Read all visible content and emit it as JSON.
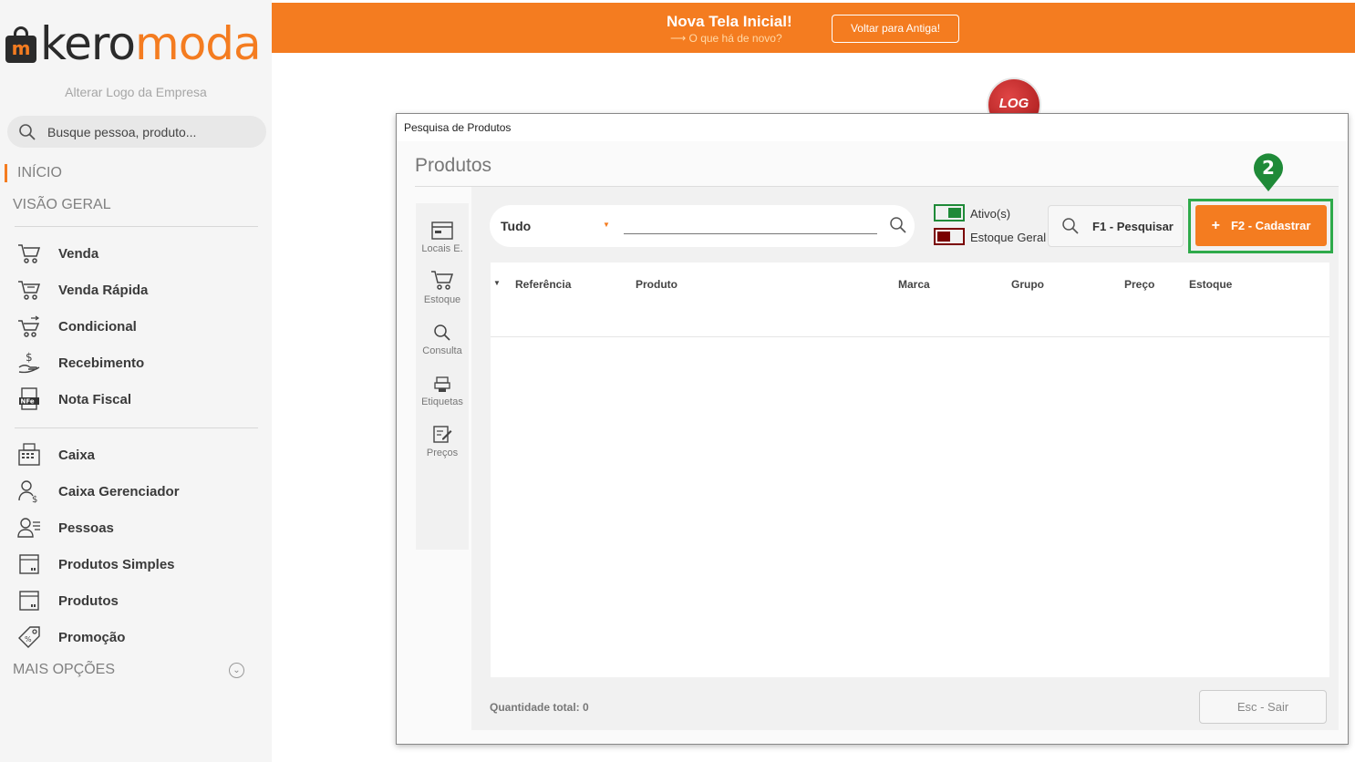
{
  "sidebar": {
    "logo": {
      "part1": "kero",
      "part2": "moda",
      "bag_letter": "m"
    },
    "alter_logo": "Alterar Logo da Empresa",
    "search_placeholder": "Busque pessoa, produto...",
    "section_inicio": "INÍCIO",
    "section_visao": "VISÃO GERAL",
    "items": [
      {
        "label": "Venda",
        "icon": "cart-icon"
      },
      {
        "label": "Venda Rápida",
        "icon": "cart-fast-icon"
      },
      {
        "label": "Condicional",
        "icon": "cart-swap-icon"
      },
      {
        "label": "Recebimento",
        "icon": "dollar-hand-icon"
      },
      {
        "label": "Nota Fiscal",
        "icon": "nfe-icon"
      },
      {
        "label": "Caixa",
        "icon": "cash-register-icon"
      },
      {
        "label": "Caixa Gerenciador",
        "icon": "user-dollar-icon"
      },
      {
        "label": "Pessoas",
        "icon": "people-icon"
      },
      {
        "label": "Produtos Simples",
        "icon": "box-icon"
      },
      {
        "label": "Produtos",
        "icon": "box-icon"
      },
      {
        "label": "Promoção",
        "icon": "tag-icon"
      }
    ],
    "more_options": "MAIS OPÇÕES"
  },
  "banner": {
    "title": "Nova Tela Inicial!",
    "subtitle": "⟶ O que há de novo?",
    "back_button": "Voltar para Antiga!"
  },
  "log_badge": "LOG",
  "dialog": {
    "window_title": "Pesquisa de Produtos",
    "heading": "Produtos",
    "tools": [
      {
        "label": "Locais E.",
        "icon": "locations-icon"
      },
      {
        "label": "Estoque",
        "icon": "cart-icon"
      },
      {
        "label": "Consulta",
        "icon": "search-icon"
      },
      {
        "label": "Etiquetas",
        "icon": "label-printer-icon"
      },
      {
        "label": "Preços",
        "icon": "edit-price-icon"
      }
    ],
    "filter": {
      "selected": "Tudo",
      "value": ""
    },
    "toggles": {
      "active_label": "Ativo(s)",
      "stock_label": "Estoque Geral"
    },
    "search_button": "F1 - Pesquisar",
    "register_button": "F2 - Cadastrar",
    "step_number": "2",
    "columns": [
      "Referência",
      "Produto",
      "Marca",
      "Grupo",
      "Preço",
      "Estoque"
    ],
    "total_label": "Quantidade total: 0",
    "exit_button": "Esc - Sair"
  },
  "colors": {
    "brand": "#f47c20",
    "highlight": "#2eaa4a",
    "active_toggle": "#1f8a38",
    "stock_toggle": "#7a0000"
  }
}
